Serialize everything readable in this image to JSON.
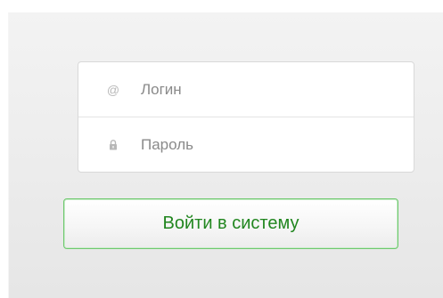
{
  "form": {
    "login": {
      "icon": "at-sign-icon",
      "icon_glyph": "@",
      "placeholder": "Логин",
      "value": ""
    },
    "password": {
      "icon": "lock-icon",
      "placeholder": "Пароль",
      "value": ""
    },
    "submit_label": "Войти в систему"
  },
  "colors": {
    "accent_green": "#21861f",
    "button_border": "#6ec86e",
    "icon_gray": "#b8b8b8"
  }
}
